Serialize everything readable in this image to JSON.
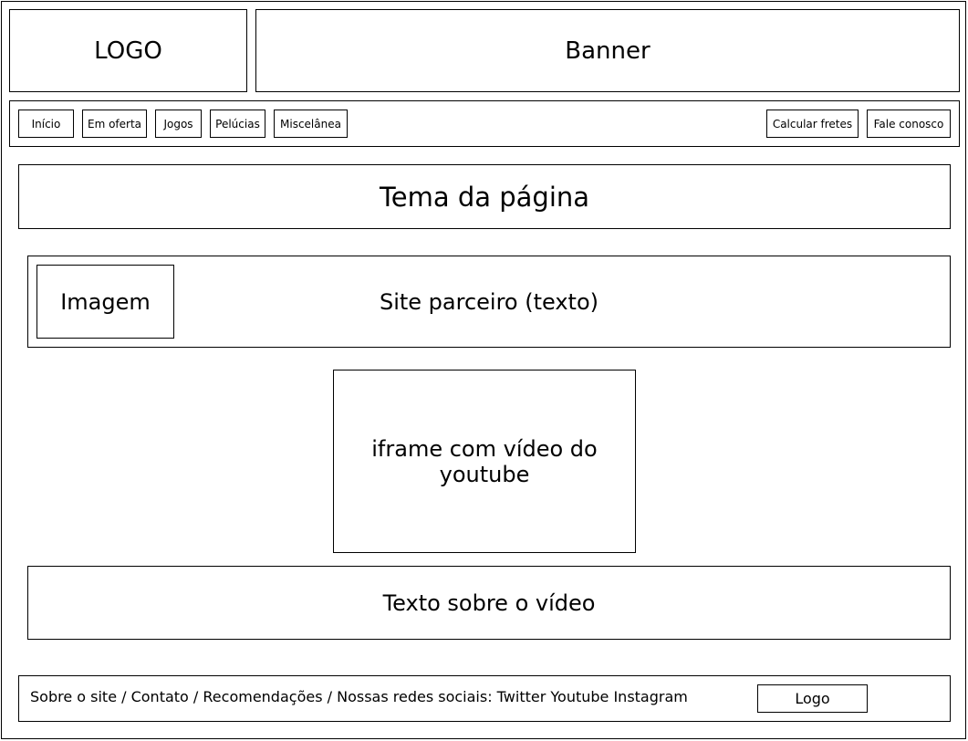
{
  "header": {
    "logo": "LOGO",
    "banner": "Banner"
  },
  "nav": {
    "items": [
      "Início",
      "Em oferta",
      "Jogos",
      "Pelúcias",
      "Miscelânea"
    ],
    "right_items": [
      "Calcular fretes",
      "Fale conosco"
    ]
  },
  "main": {
    "page_theme": "Tema da página",
    "partner_image": "Imagem",
    "partner_text": "Site parceiro (texto)",
    "video_iframe": "iframe com vídeo do youtube",
    "video_text": "Texto sobre o vídeo"
  },
  "footer": {
    "links": [
      "Sobre o site",
      "Contato",
      "Recomendações",
      "Nossas redes sociais: Twitter Youtube Instagram"
    ],
    "separator": " / ",
    "logo": "Logo"
  }
}
